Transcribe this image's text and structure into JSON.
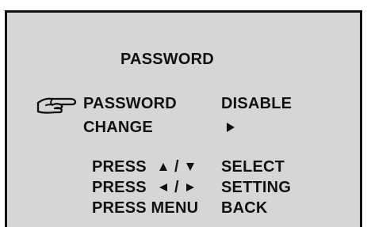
{
  "menu": {
    "title": "PASSWORD",
    "cursor_icon": "pointing-hand-icon",
    "items": [
      {
        "label": "PASSWORD",
        "value": "DISABLE"
      },
      {
        "label": "CHANGE",
        "value_icon": "triangle-right-icon"
      }
    ]
  },
  "help": [
    {
      "prefix": "PRESS",
      "keys": [
        "triangle-up-icon",
        "triangle-down-icon"
      ],
      "separator": "/",
      "action": "SELECT"
    },
    {
      "prefix": "PRESS",
      "keys": [
        "triangle-left-icon",
        "triangle-right-icon"
      ],
      "separator": "/",
      "action": "SETTING"
    },
    {
      "prefix": "PRESS MENU",
      "action": "BACK"
    }
  ]
}
